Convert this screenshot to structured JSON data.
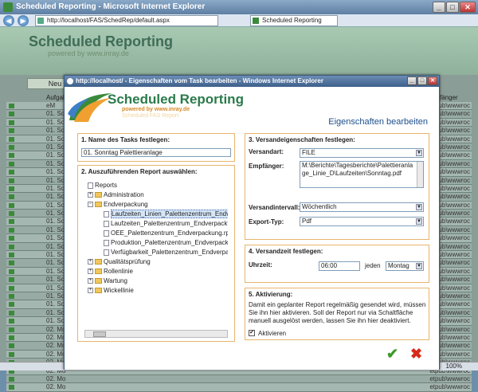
{
  "window": {
    "title": "Scheduled Reporting - Microsoft Internet Explorer"
  },
  "address": {
    "url": "http://localhost/FAS/SchedRep/default.aspx"
  },
  "browser_tab": {
    "label": "Scheduled Reporting"
  },
  "background": {
    "logo_title": "Scheduled Reporting",
    "logo_sub": "powered by www.inray.de",
    "new_button": "Neu",
    "col_header_left": "Aufgab",
    "col_header_right": "fänger",
    "rows": [
      {
        "c2": "eM",
        "c3": "etpub\\wwwroc"
      },
      {
        "c2": "01. So",
        "c3": "etpub\\wwwroc"
      },
      {
        "c2": "01. So",
        "c3": "etpub\\wwwroc"
      },
      {
        "c2": "01. So",
        "c3": "etpub\\wwwroc"
      },
      {
        "c2": "01. So",
        "c3": "etpub\\wwwroc"
      },
      {
        "c2": "01. So",
        "c3": "etpub\\wwwroc"
      },
      {
        "c2": "01. So",
        "c3": "etpub\\wwwroc"
      },
      {
        "c2": "01. So",
        "c3": "etpub\\wwwroc"
      },
      {
        "c2": "01. So",
        "c3": "etpub\\wwwroc"
      },
      {
        "c2": "01. So",
        "c3": "etpub\\wwwroc"
      },
      {
        "c2": "01. So",
        "c3": "etpub\\wwwroc"
      },
      {
        "c2": "01. So",
        "c3": "etpub\\wwwroc"
      },
      {
        "c2": "01. So",
        "c3": "etpub\\wwwroc"
      },
      {
        "c2": "01. So",
        "c3": "etpub\\wwwroc"
      },
      {
        "c2": "01. So",
        "c3": "etpub\\wwwroc"
      },
      {
        "c2": "01. So",
        "c3": "etpub\\wwwroc"
      },
      {
        "c2": "01. So",
        "c3": "etpub\\wwwroc"
      },
      {
        "c2": "01. So",
        "c3": "etpub\\wwwroc"
      },
      {
        "c2": "01. So",
        "c3": "etpub\\wwwroc"
      },
      {
        "c2": "01. So",
        "c3": "etpub\\wwwroc"
      },
      {
        "c2": "01. So",
        "c3": "etpub\\wwwroc"
      },
      {
        "c2": "01. So",
        "c3": "etpub\\wwwroc"
      },
      {
        "c2": "01. So",
        "c3": "etpub\\wwwroc"
      },
      {
        "c2": "01. So",
        "c3": "etpub\\wwwroc"
      },
      {
        "c2": "01. So",
        "c3": "etpub\\wwwroc"
      },
      {
        "c2": "01. So",
        "c3": "etpub\\wwwroc"
      },
      {
        "c2": "01. So",
        "c3": "etpub\\wwwroc"
      },
      {
        "c2": "02. Mo",
        "c3": "etpub\\wwwroc"
      },
      {
        "c2": "02. Mo",
        "c3": "etpub\\wwwroc"
      },
      {
        "c2": "02. Mo",
        "c3": "etpub\\wwwroc"
      },
      {
        "c2": "02. Mo",
        "c3": "etpub\\wwwroc"
      },
      {
        "c2": "02. Mo",
        "c3": "etpub\\wwwroc"
      },
      {
        "c2": "02. Mo",
        "c3": "etpub\\wwwroc"
      },
      {
        "c2": "02. Mo",
        "c3": "etpub\\wwwroc"
      },
      {
        "c2": "02. Mo",
        "c3": "etpub\\wwwroc"
      }
    ]
  },
  "status": {
    "zoom": "100%"
  },
  "dialog": {
    "title": "http://localhost/ - Eigenschaften vom Task bearbeiten - Windows Internet Explorer",
    "logo_title": "Scheduled Reporting",
    "logo_sub": "powered by www.inray.de",
    "logo_sub2": "Scheduled FAS Report",
    "heading": "Eigenschaften bearbeiten",
    "section1": {
      "title": "1. Name des Tasks festlegen:",
      "value": "01. Sonntag Palettieranlage"
    },
    "section2": {
      "title": "2. Auszuführenden Report auswählen:",
      "tree": {
        "root": "Reports",
        "administration": "Administration",
        "endverpackung": "Endverpackung",
        "item1": "Laufzeiten_Linien_Palettenzentrum_Endv",
        "item2": "Laufzeiten_Palettenzentrum_Endverpackt",
        "item3": "OEE_Palettenzentrum_Endverpackung.rp",
        "item4": "Produktion_Palettenzentrum_Endverpack",
        "item5": "Verfügbarkeit_Palettenzentrum_Endverpa",
        "qualitaet": "Qualitätsprüfung",
        "rollenlinie": "Rollenlinie",
        "wartung": "Wartung",
        "wickellinie": "Wickellinie"
      }
    },
    "section3": {
      "title": "3. Versandeigenschaften festlegen:",
      "versandart_label": "Versandart:",
      "versandart_value": "FILE",
      "empfaenger_label": "Empfänger:",
      "empfaenger_value": "M:\\Berichte\\Tagesberichte\\Palettieranlage_Linie_D\\Laufzeiten\\Sonntag.pdf",
      "intervall_label": "Versandintervall:",
      "intervall_value": "Wöchentlich",
      "exporttyp_label": "Export-Typ:",
      "exporttyp_value": "Pdf"
    },
    "section4": {
      "title": "4. Versandzeit festlegen:",
      "uhrzeit_label": "Uhrzeit:",
      "uhrzeit_value": "06:00",
      "jeden_label": "jeden",
      "tag_value": "Montag"
    },
    "section5": {
      "title": "5. Aktivierung:",
      "info": "Damit ein geplanter Report regelmäßig gesendet wird, müssen Sie ihn hier aktivieren. Soll der Report nur via Schaltfläche manuell ausgelöst werden, lassen Sie ihn hier deaktiviert.",
      "checkbox_label": "Aktivieren",
      "checkbox_mark": "✔"
    },
    "ok_symbol": "✔",
    "cancel_symbol": "✖"
  }
}
